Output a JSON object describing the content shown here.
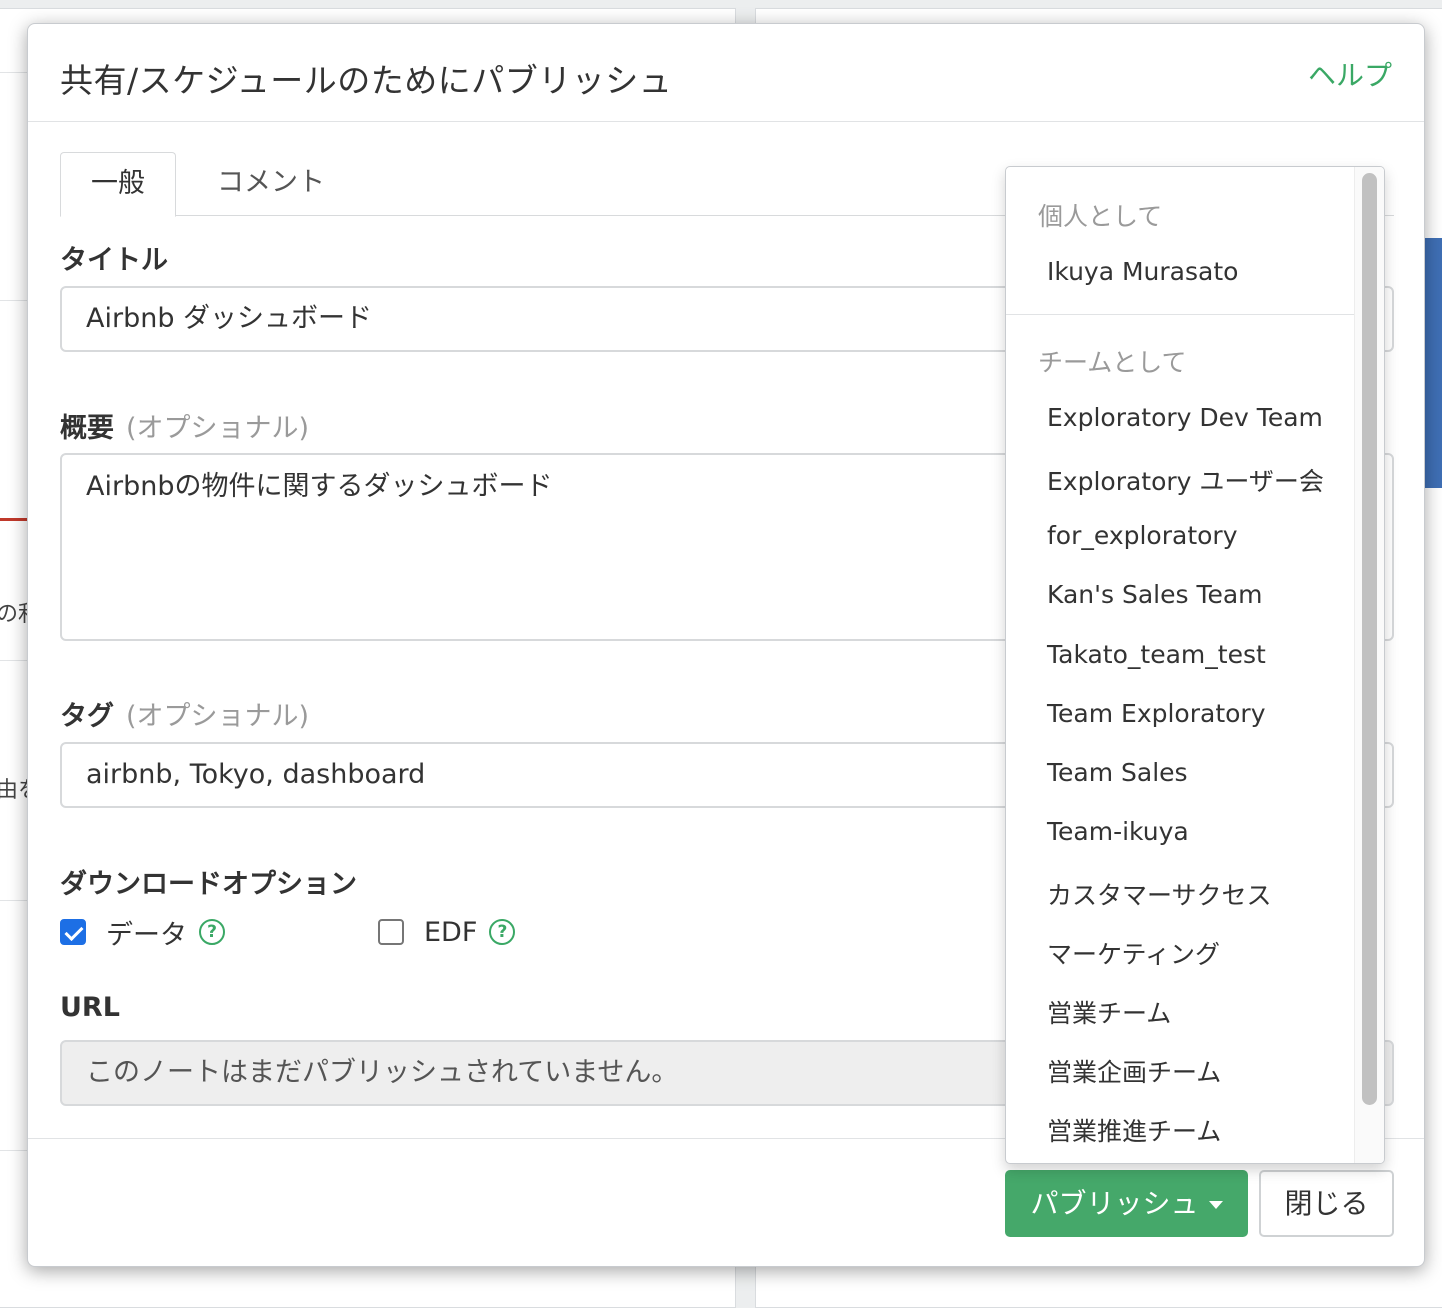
{
  "modal": {
    "title": "共有/スケジュールのためにパブリッシュ",
    "help": "ヘルプ"
  },
  "tabs": [
    "一般",
    "コメント"
  ],
  "form": {
    "title_label": "タイトル",
    "title_value": "Airbnb ダッシュボード",
    "summary_label": "概要",
    "summary_optional": "(オプショナル)",
    "summary_value": "Airbnbの物件に関するダッシュボード",
    "tags_label": "タグ",
    "tags_optional": "(オプショナル)",
    "tags_value": "airbnb, Tokyo, dashboard",
    "download_label": "ダウンロードオプション",
    "download_options": [
      {
        "label": "データ",
        "checked": true
      },
      {
        "label": "EDF",
        "checked": false
      }
    ],
    "url_label": "URL",
    "url_value": "このノートはまだパブリッシュされていません。"
  },
  "buttons": {
    "publish": "パブリッシュ",
    "close": "閉じる"
  },
  "dropdown": {
    "personal_header": "個人として",
    "personal_items": [
      "Ikuya Murasato"
    ],
    "team_header": "チームとして",
    "team_items": [
      "Exploratory Dev Team",
      "Exploratory ユーザー会",
      "for_exploratory",
      "Kan's Sales Team",
      "Takato_team_test",
      "Team Exploratory",
      "Team Sales",
      "Team-ikuya",
      "カスタマーサクセス",
      "マーケティング",
      "営業チーム",
      "営業企画チーム",
      "営業推進チーム"
    ]
  },
  "icons": {
    "help": "question-circle-icon",
    "caret": "caret-down-icon",
    "check": "checkmark-icon"
  },
  "colors": {
    "accent_green": "#45a86a",
    "link_green": "#3aa865",
    "checkbox_blue": "#1d6fe5"
  },
  "background_fragments": [
    "の利",
    "由を"
  ]
}
